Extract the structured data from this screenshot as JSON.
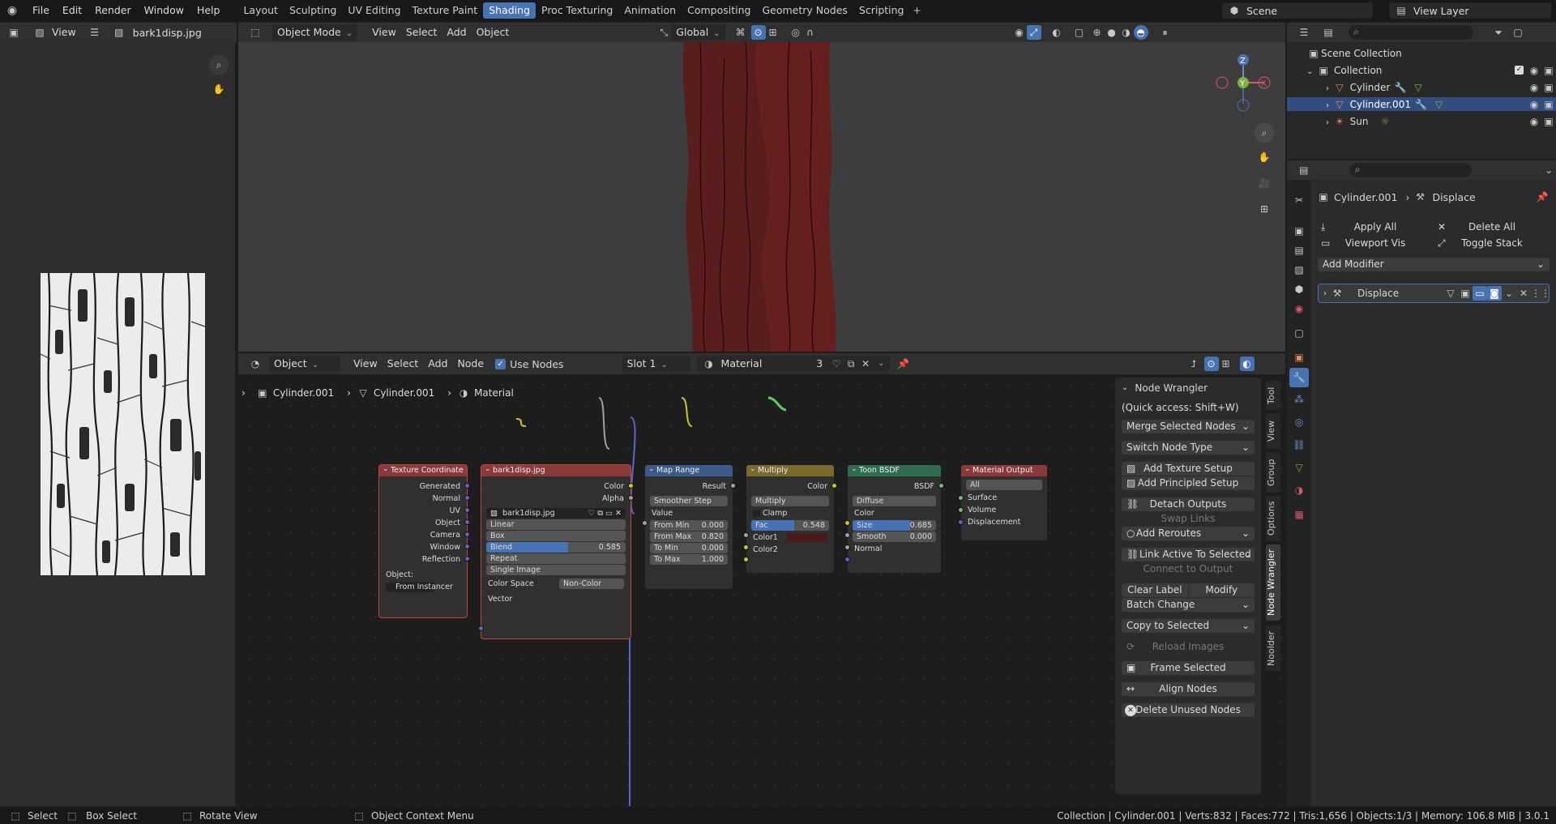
{
  "topbar": {
    "menu": [
      "File",
      "Edit",
      "Render",
      "Window",
      "Help"
    ],
    "workspaces": [
      "Layout",
      "Sculpting",
      "UV Editing",
      "Texture Paint",
      "Shading",
      "Proc Texturing",
      "Animation",
      "Compositing",
      "Geometry Nodes",
      "Scripting"
    ],
    "active_workspace": "Shading",
    "scene": "Scene",
    "view_layer": "View Layer"
  },
  "image_editor": {
    "view_label": "View",
    "image_name": "bark1disp.jpg"
  },
  "viewport": {
    "mode": "Object Mode",
    "menus": [
      "View",
      "Select",
      "Add",
      "Object"
    ],
    "orientation": "Global"
  },
  "node_editor": {
    "type": "Object",
    "menus": [
      "View",
      "Select",
      "Add",
      "Node"
    ],
    "use_nodes": "Use Nodes",
    "slot": "Slot 1",
    "material": "Material",
    "users": "3",
    "breadcrumb": [
      "Cylinder.001",
      "Cylinder.001",
      "Material"
    ]
  },
  "nodes": {
    "texcoord": {
      "title": "Texture Coordinate",
      "outputs": [
        "Generated",
        "Normal",
        "UV",
        "Object",
        "Camera",
        "Window",
        "Reflection"
      ],
      "object_label": "Object:",
      "from_instancer": "From Instancer"
    },
    "image": {
      "title": "bark1disp.jpg",
      "outputs": [
        "Color",
        "Alpha"
      ],
      "image": "bark1disp.jpg",
      "interp": "Linear",
      "proj": "Box",
      "blend_label": "Blend",
      "blend_value": "0.585",
      "extension": "Repeat",
      "source": "Single Image",
      "cs_label": "Color Space",
      "cs_value": "Non-Color",
      "input": "Vector"
    },
    "maprange": {
      "title": "Map Range",
      "output": "Result",
      "mode": "Smoother Step",
      "value": "Value",
      "rows": [
        {
          "l": "From Min",
          "v": "0.000"
        },
        {
          "l": "From Max",
          "v": "0.820"
        },
        {
          "l": "To Min",
          "v": "0.000"
        },
        {
          "l": "To Max",
          "v": "1.000"
        }
      ]
    },
    "multiply": {
      "title": "Multiply",
      "output": "Color",
      "mode": "Multiply",
      "clamp": "Clamp",
      "fac_label": "Fac",
      "fac_value": "0.548",
      "color1": "Color1",
      "color2": "Color2"
    },
    "toon": {
      "title": "Toon BSDF",
      "output": "BSDF",
      "mode": "Diffuse",
      "color": "Color",
      "size_label": "Size",
      "size_value": "0.685",
      "smooth_label": "Smooth",
      "smooth_value": "0.000",
      "normal": "Normal"
    },
    "output": {
      "title": "Material Output",
      "target": "All",
      "inputs": [
        "Surface",
        "Volume",
        "Displacement"
      ]
    }
  },
  "node_wrangler": {
    "title": "Node Wrangler",
    "quick": "(Quick access: Shift+W)",
    "merge": "Merge Selected Nodes",
    "switch": "Switch Node Type",
    "add_texture": "Add Texture Setup",
    "add_principled": "Add Principled Setup",
    "detach": "Detach Outputs",
    "swap": "Swap Links",
    "reroutes": "Add Reroutes",
    "link_active": "Link Active To Selected",
    "connect_output": "Connect to Output",
    "clear_label": "Clear Label",
    "modify_labels": "Modify Labels",
    "batch": "Batch Change",
    "copy_selected": "Copy to Selected",
    "reload": "Reload Images",
    "frame": "Frame Selected",
    "align": "Align Nodes",
    "delete_unused": "Delete Unused Nodes"
  },
  "side_tabs": [
    "Tool",
    "View",
    "Group",
    "Options",
    "Node Wrangler",
    "Noolder"
  ],
  "outliner": {
    "scene_collection": "Scene Collection",
    "collection": "Collection",
    "items": [
      "Cylinder",
      "Cylinder.001",
      "Sun"
    ]
  },
  "properties": {
    "object": "Cylinder.001",
    "modifier_ctx": "Displace",
    "apply_all": "Apply All",
    "delete_all": "Delete All",
    "viewport_vis": "Viewport Vis",
    "toggle_stack": "Toggle Stack",
    "add_modifier": "Add Modifier",
    "modifier": "Displace"
  },
  "statusbar": {
    "select": "Select",
    "box_select": "Box Select",
    "rotate": "Rotate View",
    "context": "Object Context Menu",
    "info": "Collection | Cylinder.001 | Verts:832 | Faces:772 | Tris:1,656 | Objects:1/3 | Memory: 106.8 MiB | 3.0.1"
  },
  "colors": {
    "accent": "#4772b3",
    "texture_header": "#8b3a3a",
    "vector_header": "#3b5a8a",
    "color_header": "#7a6a2e",
    "shader_header": "#2f6b4f",
    "output_header": "#8b3a3a",
    "socket_yellow": "#c7c729",
    "socket_grey": "#a1a1a1",
    "socket_purple": "#6363c7",
    "socket_green": "#63c763",
    "multiply_color": "#4a1a1a",
    "trunk": "#5a1d1d"
  }
}
